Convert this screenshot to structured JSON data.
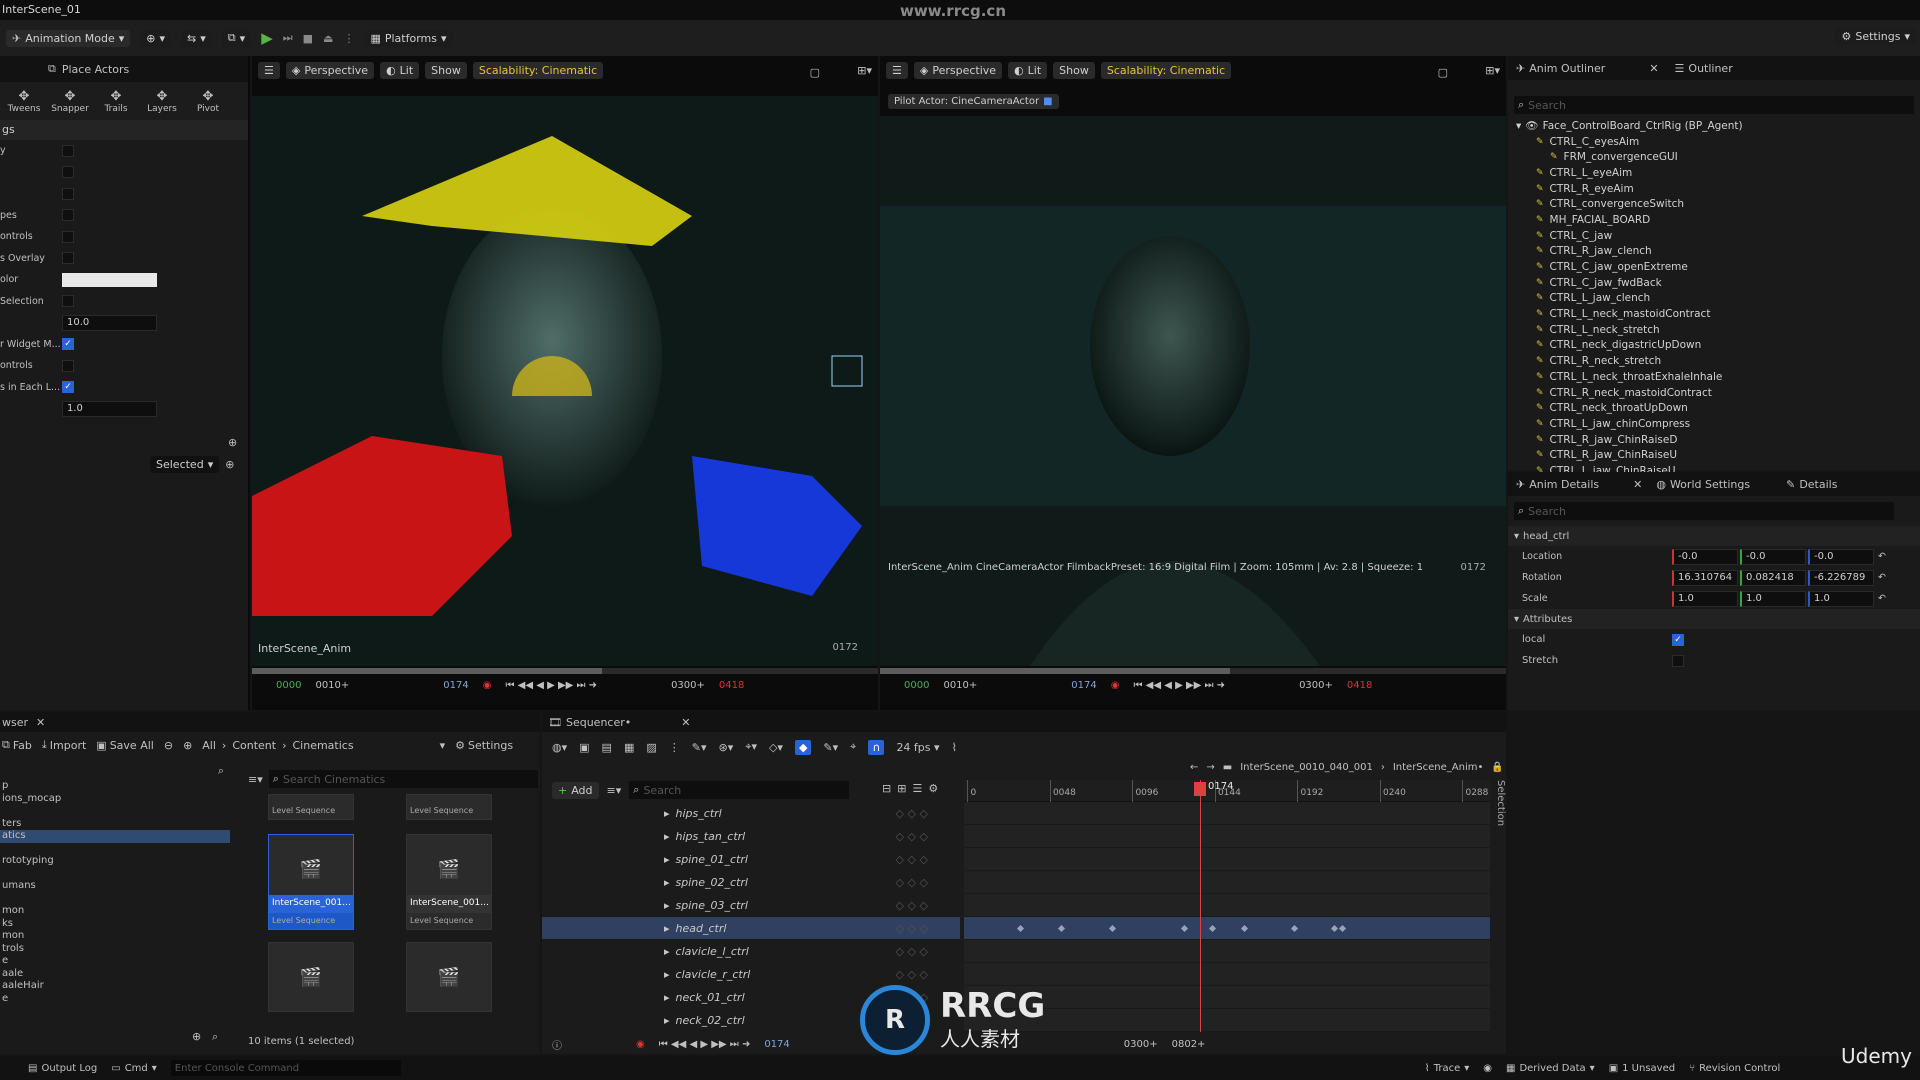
{
  "window": {
    "title": "InterScene_01",
    "watermark": "www.rrcg.cn",
    "udemy": "Udemy"
  },
  "toolbar": {
    "mode": "Animation Mode",
    "platforms": "Platforms",
    "settings": "Settings"
  },
  "left_panel": {
    "tab": "Place Actors",
    "tools": [
      {
        "label": "Tweens",
        "icon": "tweens-icon"
      },
      {
        "label": "Snapper",
        "icon": "snapper-icon"
      },
      {
        "label": "Trails",
        "icon": "trails-icon"
      },
      {
        "label": "Layers",
        "icon": "layers-icon"
      },
      {
        "label": "Pivot",
        "icon": "pivot-icon"
      }
    ],
    "section": "gs",
    "props": [
      {
        "label": "y",
        "type": "check",
        "checked": false
      },
      {
        "label": "",
        "type": "check",
        "checked": false
      },
      {
        "label": "",
        "type": "check",
        "checked": false
      },
      {
        "label": "pes",
        "type": "check",
        "checked": false
      },
      {
        "label": "ontrols",
        "type": "check",
        "checked": false
      },
      {
        "label": "s Overlay",
        "type": "check",
        "checked": false
      },
      {
        "label": "olor",
        "type": "color",
        "value": ""
      },
      {
        "label": "Selection",
        "type": "check",
        "checked": false
      },
      {
        "label": "",
        "type": "field",
        "value": "10.0"
      },
      {
        "label": "r Widget M...",
        "type": "check",
        "checked": true
      },
      {
        "label": "ontrols",
        "type": "check",
        "checked": false
      },
      {
        "label": "s in Each L...",
        "type": "check",
        "checked": true
      },
      {
        "label": "",
        "type": "field",
        "value": "1.0"
      }
    ],
    "selected_dropdown": "Selected"
  },
  "viewport_left": {
    "perspective": "Perspective",
    "lit": "Lit",
    "show": "Show",
    "scalability": "Scalability: Cinematic",
    "label": "InterScene_Anim",
    "frame": "0172",
    "transport": {
      "start": "0000",
      "in": "0010+",
      "current": "0174",
      "out": "0300+",
      "end": "0418"
    }
  },
  "viewport_right": {
    "perspective": "Perspective",
    "lit": "Lit",
    "show": "Show",
    "scalability": "Scalability: Cinematic",
    "pilot": "Pilot Actor: CineCameraActor",
    "camera_info": "InterScene_Anim CineCameraActor FilmbackPreset: 16:9 Digital Film | Zoom: 105mm | Av: 2.8 | Squeeze: 1",
    "frame": "0172",
    "transport": {
      "start": "0000",
      "in": "0010+",
      "current": "0174",
      "out": "0300+",
      "end": "0418"
    }
  },
  "outliner": {
    "tabs": [
      "Anim Outliner",
      "Outliner"
    ],
    "search_placeholder": "Search",
    "root": "Face_ControlBoard_CtrlRig (BP_Agent)",
    "items": [
      "CTRL_C_eyesAim",
      "FRM_convergenceGUI",
      "CTRL_L_eyeAim",
      "CTRL_R_eyeAim",
      "CTRL_convergenceSwitch",
      "MH_FACIAL_BOARD",
      "CTRL_C_jaw",
      "CTRL_R_jaw_clench",
      "CTRL_C_jaw_openExtreme",
      "CTRL_C_jaw_fwdBack",
      "CTRL_L_jaw_clench",
      "CTRL_L_neck_mastoidContract",
      "CTRL_L_neck_stretch",
      "CTRL_neck_digastricUpDown",
      "CTRL_R_neck_stretch",
      "CTRL_L_neck_throatExhaleInhale",
      "CTRL_R_neck_mastoidContract",
      "CTRL_neck_throatUpDown",
      "CTRL_L_jaw_chinCompress",
      "CTRL_R_jaw_ChinRaiseD",
      "CTRL_R_jaw_ChinRaiseU",
      "CTRL_L_jaw_ChinRaiseU"
    ]
  },
  "details": {
    "tabs": [
      "Anim Details",
      "World Settings",
      "Details"
    ],
    "search_placeholder": "Search",
    "section": "head_ctrl",
    "rows": [
      {
        "label": "Location",
        "values": [
          "-0.0",
          "-0.0",
          "-0.0"
        ]
      },
      {
        "label": "Rotation",
        "values": [
          "16.310764",
          "0.082418",
          "-6.226789"
        ]
      },
      {
        "label": "Scale",
        "values": [
          "1.0",
          "1.0",
          "1.0"
        ]
      }
    ],
    "attributes": "Attributes",
    "attr_rows": [
      {
        "label": "local",
        "checked": true
      },
      {
        "label": "Stretch",
        "checked": false
      }
    ]
  },
  "browser": {
    "tab": "wser",
    "fab": "Fab",
    "import": "Import",
    "save_all": "Save All",
    "settings": "Settings",
    "breadcrumb": [
      "All",
      "Content",
      "Cinematics"
    ],
    "search_placeholder": "Search Cinematics",
    "folders": [
      "p",
      "ions_mocap",
      "",
      "ters",
      "atics",
      "",
      "rototyping",
      "",
      "umans",
      "",
      "mon",
      "ks",
      "mon",
      "trols",
      "e",
      "aale",
      "aaleHair",
      "e"
    ],
    "assets": [
      {
        "name": "",
        "type": "Level Sequence"
      },
      {
        "name": "",
        "type": "Level Sequence"
      },
      {
        "name": "InterScene_001...",
        "type": "Level Sequence"
      },
      {
        "name": "InterScene_001...",
        "type": "Level Sequence"
      },
      {
        "name": "",
        "type": ""
      },
      {
        "name": "",
        "type": ""
      }
    ],
    "status": "10 items (1 selected)"
  },
  "sequencer": {
    "tab": "Sequencer•",
    "fps": "24 fps",
    "add": "Add",
    "search_placeholder": "Search",
    "breadcrumb": [
      "InterScene_0010_040_001",
      "InterScene_Anim•"
    ],
    "playhead": "0174",
    "ruler": [
      "0",
      "0048",
      "0096",
      "0144",
      "0192",
      "0240",
      "0288"
    ],
    "tracks": [
      "hips_ctrl",
      "hips_tan_ctrl",
      "spine_01_ctrl",
      "spine_02_ctrl",
      "spine_03_ctrl",
      "head_ctrl",
      "clavicle_l_ctrl",
      "clavicle_r_ctrl",
      "neck_01_ctrl",
      "neck_02_ctrl"
    ],
    "selected_track": "head_ctrl",
    "bottom": {
      "current": "0174",
      "out": "0300+",
      "end": "0802+"
    },
    "selection_label": "Selection"
  },
  "statusbar": {
    "output_log": "Output Log",
    "cmd": "Cmd",
    "console_placeholder": "Enter Console Command",
    "trace": "Trace",
    "derived": "Derived Data",
    "unsaved": "1 Unsaved",
    "revision": "Revision Control"
  },
  "logo": {
    "text": "RRCG",
    "sub": "人人素材"
  }
}
